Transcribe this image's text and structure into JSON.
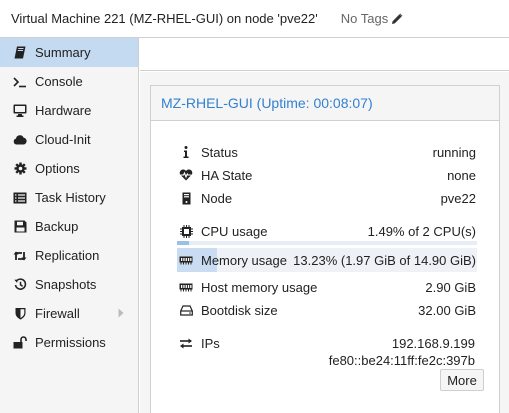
{
  "header": {
    "title": "Virtual Machine 221 (MZ-RHEL-GUI) on node 'pve22'",
    "tags_label": "No Tags"
  },
  "sidebar": {
    "items": [
      {
        "label": "Summary",
        "icon": "book-icon",
        "active": true
      },
      {
        "label": "Console",
        "icon": "terminal-icon"
      },
      {
        "label": "Hardware",
        "icon": "desktop-icon"
      },
      {
        "label": "Cloud-Init",
        "icon": "cloud-icon"
      },
      {
        "label": "Options",
        "icon": "gear-icon"
      },
      {
        "label": "Task History",
        "icon": "list-icon"
      },
      {
        "label": "Backup",
        "icon": "floppy-icon"
      },
      {
        "label": "Replication",
        "icon": "retweet-icon"
      },
      {
        "label": "Snapshots",
        "icon": "history-icon"
      },
      {
        "label": "Firewall",
        "icon": "shield-icon",
        "has_submenu": true
      },
      {
        "label": "Permissions",
        "icon": "unlock-icon"
      }
    ]
  },
  "summary": {
    "heading": "MZ-RHEL-GUI (Uptime: 00:08:07)",
    "status": {
      "label": "Status",
      "value": "running"
    },
    "ha_state": {
      "label": "HA State",
      "value": "none"
    },
    "node": {
      "label": "Node",
      "value": "pve22"
    },
    "cpu": {
      "label": "CPU usage",
      "value": "1.49% of 2 CPU(s)",
      "fraction": 0.0149
    },
    "memory": {
      "label": "Memory usage",
      "value": "13.23% (1.97 GiB of 14.90 GiB)",
      "fraction": 0.1323
    },
    "host_memory": {
      "label": "Host memory usage",
      "value": "2.90 GiB"
    },
    "bootdisk": {
      "label": "Bootdisk size",
      "value": "32.00 GiB"
    },
    "ips": {
      "label": "IPs",
      "values": [
        "192.168.9.199",
        "fe80::be24:11ff:fe2c:397b"
      ]
    },
    "more_label": "More"
  },
  "colors": {
    "accent": "#3381cf",
    "active_nav": "#c4daf1",
    "bar_fill": "#9bc0e6"
  }
}
